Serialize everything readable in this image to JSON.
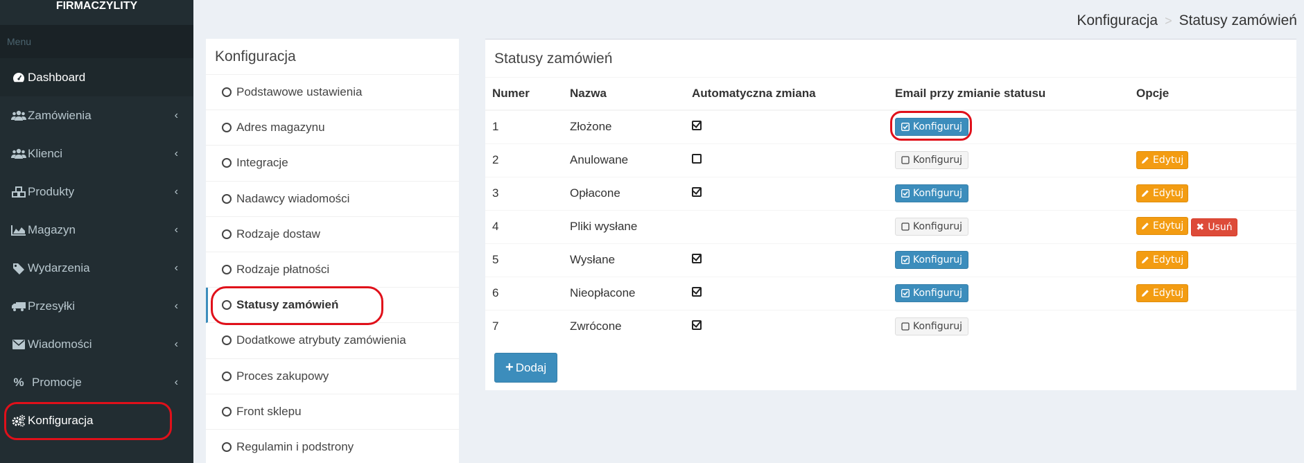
{
  "sidebar": {
    "brand": "FIRMACZYLITY",
    "header": "Menu",
    "items": [
      {
        "label": "Dashboard",
        "icon": "dashboard-icon"
      },
      {
        "label": "Zamówienia",
        "icon": "users-icon"
      },
      {
        "label": "Klienci",
        "icon": "users-icon"
      },
      {
        "label": "Produkty",
        "icon": "cubes-icon"
      },
      {
        "label": "Magazyn",
        "icon": "area-chart-icon"
      },
      {
        "label": "Wydarzenia",
        "icon": "tag-icon"
      },
      {
        "label": "Przesyłki",
        "icon": "truck-icon"
      },
      {
        "label": "Wiadomości",
        "icon": "envelope-icon"
      },
      {
        "label": "Promocje",
        "icon": "percent-icon"
      },
      {
        "label": "Konfiguracja",
        "icon": "cogs-icon"
      }
    ]
  },
  "breadcrumb": {
    "parent": "Konfiguracja",
    "separator": ">",
    "current": "Statusy zamówień"
  },
  "config_menu": {
    "title": "Konfiguracja",
    "items": [
      "Podstawowe ustawienia",
      "Adres magazynu",
      "Integracje",
      "Nadawcy wiadomości",
      "Rodzaje dostaw",
      "Rodzaje płatności",
      "Statusy zamówień",
      "Dodatkowe atrybuty zamówienia",
      "Proces zakupowy",
      "Front sklepu",
      "Regulamin i podstrony"
    ]
  },
  "statuses": {
    "title": "Statusy zamówień",
    "headers": {
      "number": "Numer",
      "name": "Nazwa",
      "auto": "Automatyczna zmiana",
      "email": "Email przy zmianie statusu",
      "options": "Opcje"
    },
    "configure_label": "Konfiguruj",
    "edit_label": "Edytuj",
    "delete_label": "Usuń",
    "add_label": "Dodaj",
    "rows": [
      {
        "number": "1",
        "name": "Złożone"
      },
      {
        "number": "2",
        "name": "Anulowane"
      },
      {
        "number": "3",
        "name": "Opłacone"
      },
      {
        "number": "4",
        "name": "Pliki wysłane"
      },
      {
        "number": "5",
        "name": "Wysłane"
      },
      {
        "number": "6",
        "name": "Nieopłacone"
      },
      {
        "number": "7",
        "name": "Zwrócone"
      }
    ]
  },
  "colors": {
    "sidebar_bg": "#222d32",
    "primary": "#3c8dbc",
    "warning": "#f39c12",
    "danger": "#dd4b39",
    "annotation": "#e0101a"
  }
}
